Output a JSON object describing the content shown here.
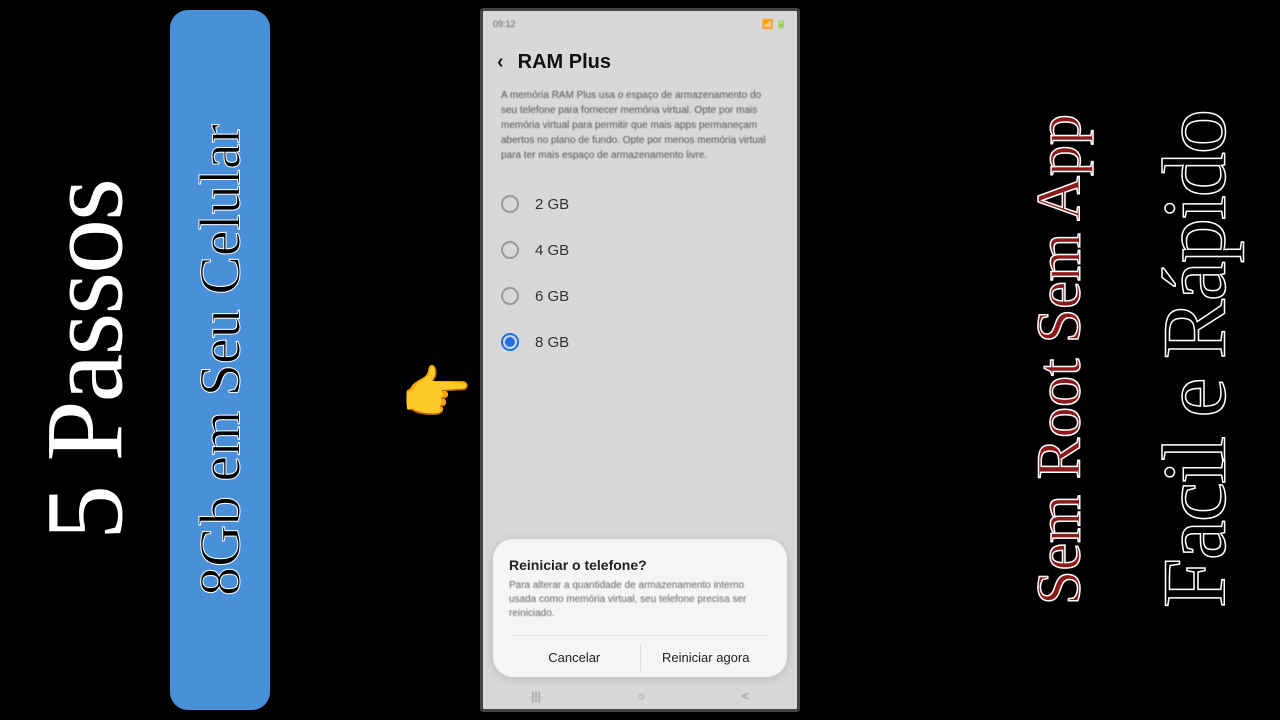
{
  "banners": {
    "left1": "5 Passos",
    "left2": "8Gb em Seu Celular",
    "right1": "Sem Root Sem App",
    "right2": "Facil e Rápido"
  },
  "phone": {
    "status_left": "09:12",
    "status_right": "📶 🔋",
    "back_glyph": "‹",
    "title": "RAM Plus",
    "description": "A memória RAM Plus usa o espaço de armazenamento do seu telefone para fornecer memória virtual. Opte por mais memória virtual para permitir que mais apps permaneçam abertos no plano de fundo. Opte por menos memória virtual para ter mais espaço de armazenamento livre.",
    "options": [
      {
        "label": "2 GB",
        "selected": false
      },
      {
        "label": "4 GB",
        "selected": false
      },
      {
        "label": "6 GB",
        "selected": false
      },
      {
        "label": "8 GB",
        "selected": true
      }
    ],
    "dialog": {
      "title": "Reiniciar o telefone?",
      "body": "Para alterar a quantidade de armazenamento interno usada como memória virtual, seu telefone precisa ser reiniciado.",
      "cancel": "Cancelar",
      "confirm": "Reiniciar agora"
    },
    "nav": {
      "recent": "|||",
      "home": "○",
      "back": "<"
    }
  },
  "pointer_glyph": "👉"
}
